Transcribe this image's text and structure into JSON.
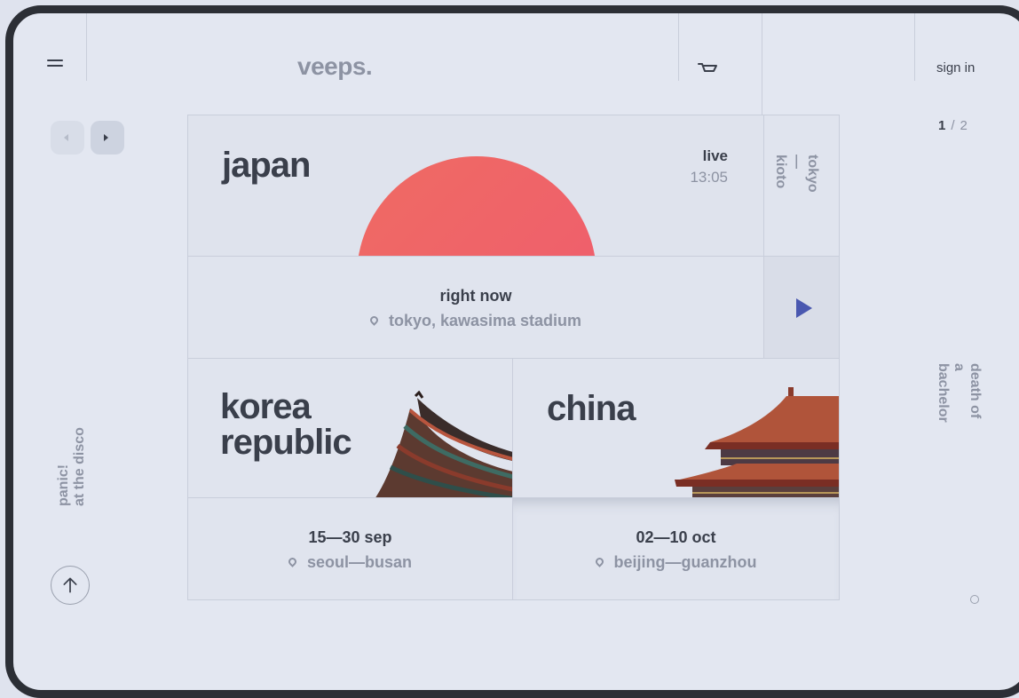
{
  "header": {
    "logo": "veeps.",
    "sign_in": "sign in"
  },
  "pager": {
    "current": "1",
    "separator": "/",
    "total": "2"
  },
  "side": {
    "left_label": "panic!\nat the disco",
    "right_label": "death of\na bachelor"
  },
  "featured": {
    "country": "japan",
    "status": "live",
    "time": "13:05",
    "route": "tokyo—\nkioto",
    "now_title": "right now",
    "now_location": "tokyo, kawasima stadium"
  },
  "events": [
    {
      "country": "korea\nrepublic",
      "dates": "15—30 sep",
      "location": "seoul—busan"
    },
    {
      "country": "china",
      "dates": "02—10 oct",
      "location": "beijing—guanzhou"
    }
  ],
  "colors": {
    "background": "#e3e7f1",
    "text_dark": "#3a3f4b",
    "text_muted": "#8d93a3",
    "sun": "#ef6b63",
    "play": "#4a58b0"
  }
}
